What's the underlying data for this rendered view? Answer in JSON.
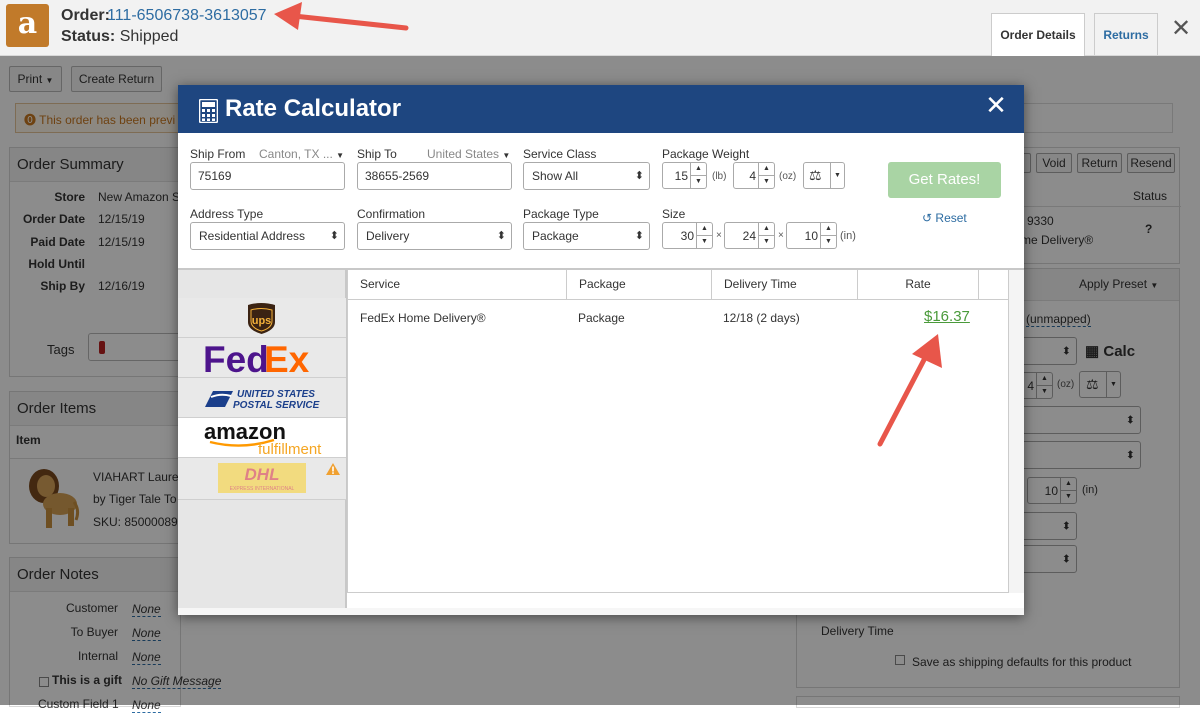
{
  "header": {
    "order_label": "Order:",
    "order_number": "111-6506738-3613057",
    "status_label": "Status:",
    "status_value": "Shipped",
    "tab_order_details": "Order Details",
    "tab_returns": "Returns"
  },
  "toolbar": {
    "print": "Print",
    "create_return": "Create Return"
  },
  "alert": {
    "text": "This order has been previ"
  },
  "summary": {
    "title": "Order Summary",
    "rows": [
      {
        "k": "Store",
        "v": "New Amazon S"
      },
      {
        "k": "Order Date",
        "v": "12/15/19"
      },
      {
        "k": "Paid Date",
        "v": "12/15/19"
      },
      {
        "k": "Hold Until",
        "v": ""
      },
      {
        "k": "Ship By",
        "v": "12/16/19"
      }
    ],
    "tags_label": "Tags"
  },
  "items": {
    "title": "Order Items",
    "col_item": "Item",
    "item_name": "VIAHART Laure",
    "item_by": "by Tiger Tale To",
    "item_sku": "SKU: 85000089"
  },
  "notes": {
    "title": "Order Notes",
    "customer_label": "Customer",
    "customer_val": "None",
    "tobuyer_label": "To Buyer",
    "tobuyer_val": "None",
    "internal_label": "Internal",
    "internal_val": "None",
    "gift_label": "This is a gift",
    "gift_val": "No Gift Message",
    "custom_label": "Custom Field 1",
    "custom_val": "None"
  },
  "right": {
    "void": "Void",
    "return": "Return",
    "resend": "Resend",
    "status_col": "Status",
    "tracking_partial": "9330",
    "delivery_partial": "me Delivery®",
    "apply_preset": "Apply Preset",
    "unmapped": "(unmapped)",
    "calc": "Calc",
    "weight_partial": "4",
    "oz": "(oz)",
    "size_partial": "10",
    "in": "(in)",
    "reg_partial": "®",
    "delivery_time": "Delivery Time",
    "save_defaults": "Save as shipping defaults for this product"
  },
  "modal": {
    "title": "Rate Calculator",
    "ship_from_label": "Ship From",
    "ship_from_select": "Canton, TX ...",
    "ship_from_zip": "75169",
    "ship_to_label": "Ship To",
    "ship_to_select": "United States",
    "ship_to_zip": "38655-2569",
    "service_class_label": "Service Class",
    "service_class_value": "Show All",
    "weight_label": "Package Weight",
    "weight_lb": "15",
    "unit_lb": "(lb)",
    "weight_oz": "4",
    "unit_oz": "(oz)",
    "get_rates": "Get Rates!",
    "reset": "Reset",
    "address_type_label": "Address Type",
    "address_type_value": "Residential Address",
    "confirmation_label": "Confirmation",
    "confirmation_value": "Delivery",
    "package_type_label": "Package Type",
    "package_type_value": "Package",
    "size_label": "Size",
    "size_l": "30",
    "size_w": "24",
    "size_h": "10",
    "times": "×",
    "unit_in": "(in)"
  },
  "carriers": {
    "ups": "ups",
    "fedex_fe": "Fed",
    "fedex_ex": "Ex",
    "usps_1": "UNITED STATES",
    "usps_2": "POSTAL SERVICE",
    "amazon_1": "amazon",
    "amazon_2": "fulfillment",
    "dhl": "DHL",
    "dhl_sub": "EXPRESS INTERNATIONAL"
  },
  "table": {
    "columns": [
      "Service",
      "Package",
      "Delivery Time",
      "Rate"
    ],
    "rows": [
      {
        "service": "FedEx Home Delivery®",
        "package": "Package",
        "delivery": "12/18 (2 days)",
        "rate": "$16.37"
      }
    ]
  },
  "colors": {
    "modal_header": "#1e4680",
    "rate_green": "#4a9a3a",
    "get_rates_bg": "#a9d4a4",
    "annotation_arrow": "#e8564a"
  }
}
